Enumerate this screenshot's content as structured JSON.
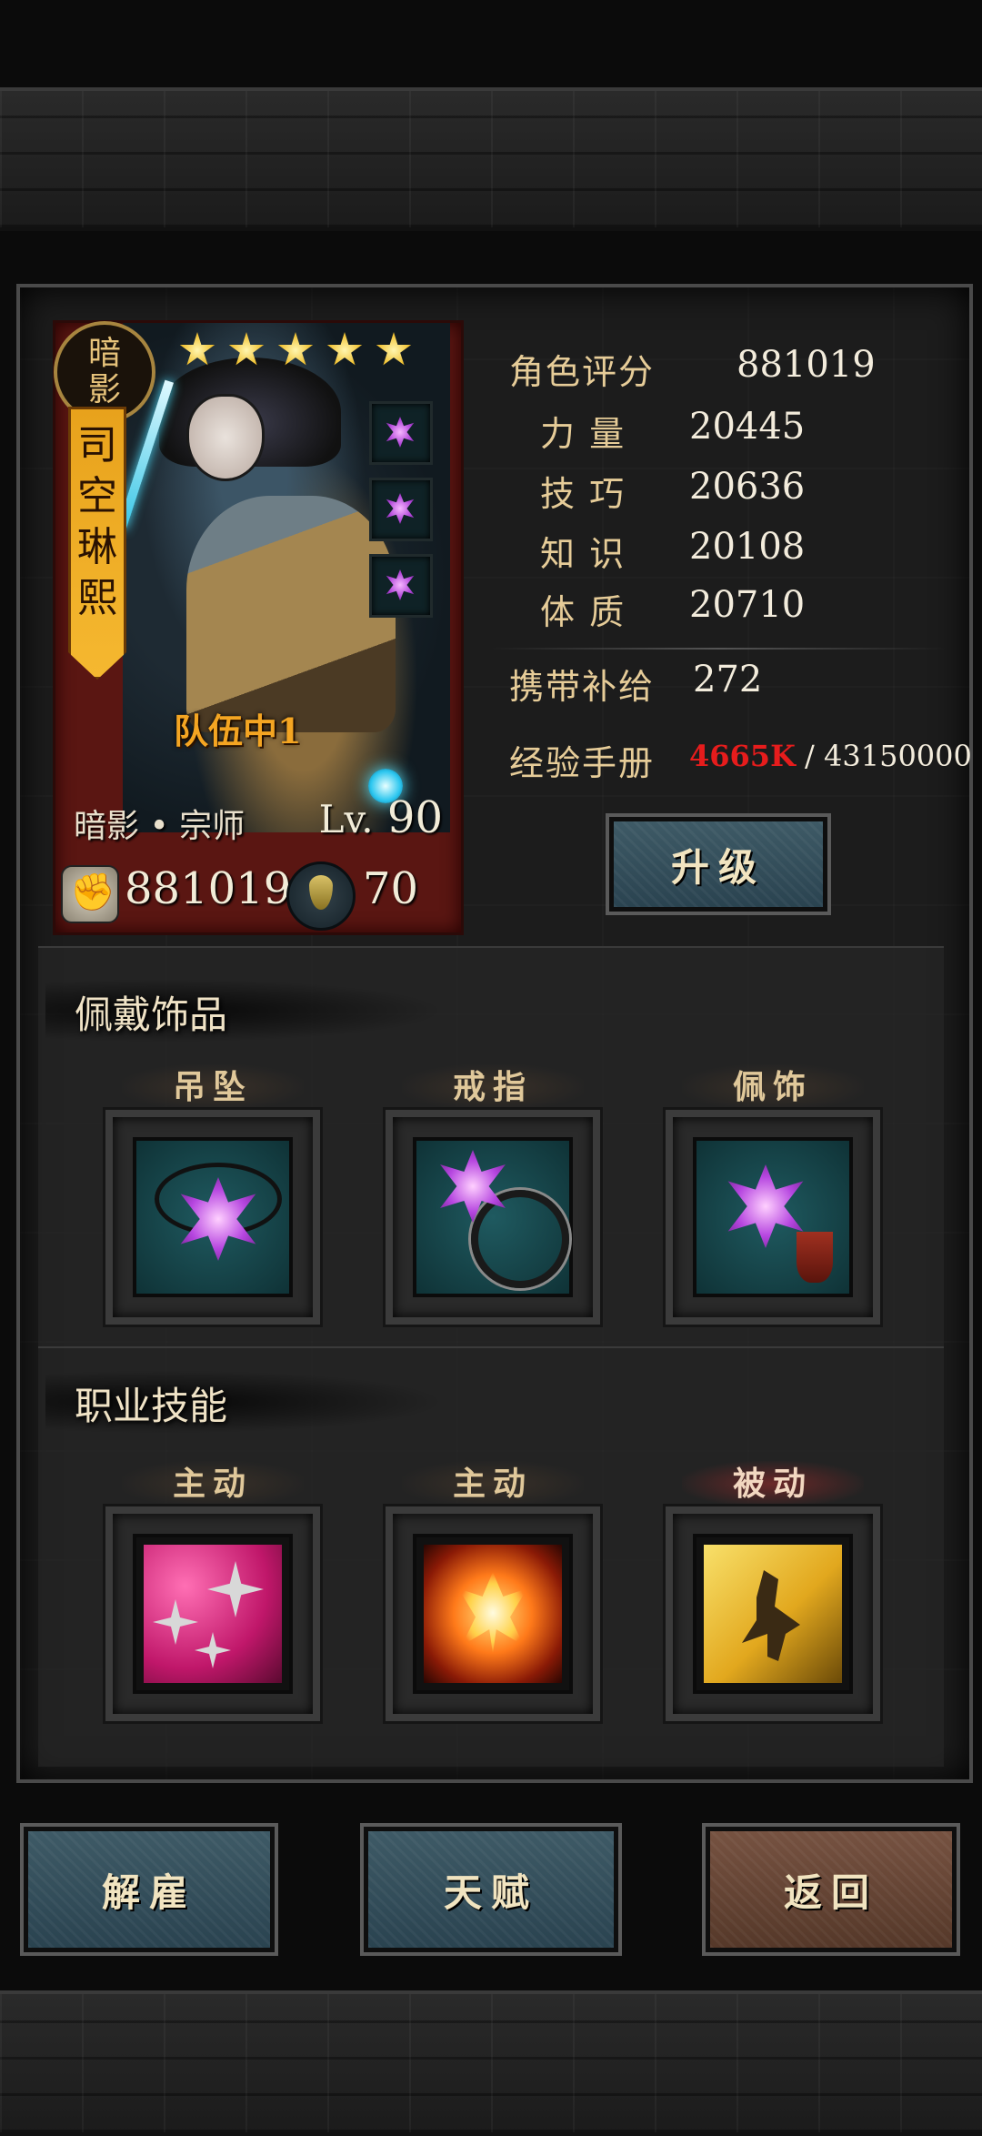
{
  "hero": {
    "class_seal": [
      "暗",
      "影"
    ],
    "name_chars": [
      "司",
      "空",
      "琳",
      "熙"
    ],
    "stars": 5,
    "team_label": "队伍中1",
    "class_rank": "暗影 • 宗师",
    "level_prefix": "Lv.",
    "level": "90",
    "combat_power": "881019",
    "supply_icon_value": "70",
    "equipped_mini_icons": [
      "pendant-icon",
      "ring-icon",
      "ornament-icon"
    ]
  },
  "stats": {
    "rating_label": "角色评分",
    "rating_value": "881019",
    "str_label": "力 量",
    "str_value": "20445",
    "skill_label": "技 巧",
    "skill_value": "20636",
    "know_label": "知 识",
    "know_value": "20108",
    "con_label": "体 质",
    "con_value": "20710",
    "supply_label": "携带补给",
    "supply_value": "272",
    "exp_label": "经验手册",
    "exp_current": "4665K",
    "exp_total": "/ 43150000"
  },
  "upgrade_button": "升级",
  "accessories": {
    "title": "佩戴饰品",
    "slots": [
      {
        "label": "吊坠",
        "icon": "pendant-icon"
      },
      {
        "label": "戒指",
        "icon": "ring-icon"
      },
      {
        "label": "佩饰",
        "icon": "ornament-icon"
      }
    ]
  },
  "skills": {
    "title": "职业技能",
    "slots": [
      {
        "label": "主动",
        "icon": "shuriken-skill-icon"
      },
      {
        "label": "主动",
        "icon": "phoenix-skill-icon"
      },
      {
        "label": "被动",
        "icon": "dash-skill-icon"
      }
    ]
  },
  "bottom_buttons": {
    "dismiss": "解雇",
    "talent": "天赋",
    "back": "返回"
  },
  "colors": {
    "exp_current": "#e61c1c",
    "name_banner": "#f5b830",
    "portrait_bg": "#5a1612",
    "button_blue": "#2a4350",
    "button_brown": "#553829"
  }
}
